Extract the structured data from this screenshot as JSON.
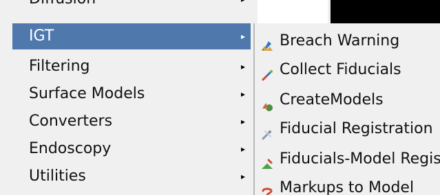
{
  "menu": {
    "top_partial_label": "Diffusion",
    "items": [
      {
        "label": "IGT",
        "selected": true
      },
      {
        "label": "Filtering",
        "selected": false
      },
      {
        "label": "Surface Models",
        "selected": false
      },
      {
        "label": "Converters",
        "selected": false
      },
      {
        "label": "Endoscopy",
        "selected": false
      },
      {
        "label": "Utilities",
        "selected": false
      }
    ],
    "arrow_glyph": "▸"
  },
  "submenu": {
    "items": [
      {
        "label": "Breach Warning",
        "icon": "breach-warning-icon"
      },
      {
        "label": "Collect Fiducials",
        "icon": "collect-fiducials-icon"
      },
      {
        "label": "CreateModels",
        "icon": "create-models-icon"
      },
      {
        "label": "Fiducial Registration",
        "icon": "fiducial-registration-icon"
      },
      {
        "label": "Fiducials-Model Registration",
        "icon": "fiducials-model-registration-icon"
      },
      {
        "label": "Markups to Model",
        "icon": "markups-to-model-icon"
      }
    ]
  },
  "colors": {
    "menu_bg": "#f0f0f0",
    "selected_bg": "#4f79ad",
    "selected_text": "#ffffff",
    "text": "#111111"
  }
}
